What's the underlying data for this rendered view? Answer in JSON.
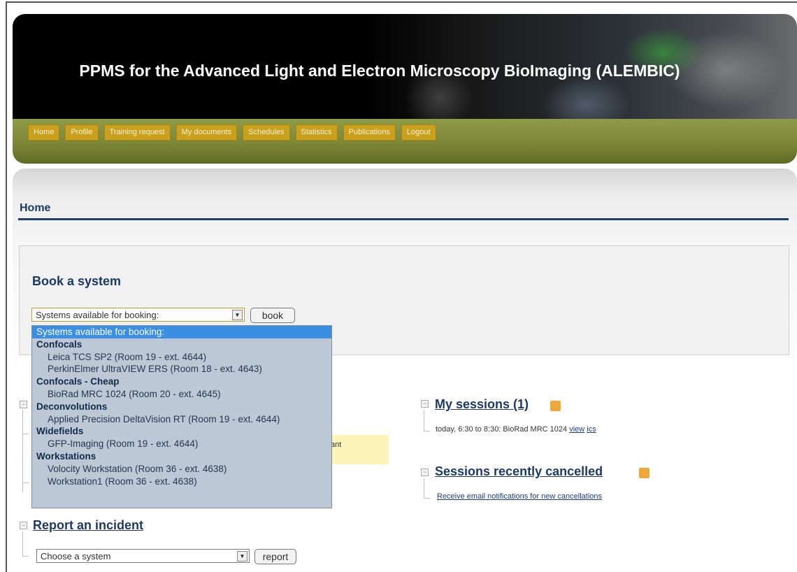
{
  "header": {
    "site_title": "PPMS for the Advanced Light and Electron Microscopy BioImaging (ALEMBIC)",
    "nav": [
      "Home",
      "Profile",
      "Training request",
      "My documents",
      "Schedules",
      "Statistics",
      "Publications",
      "Logout"
    ]
  },
  "page": {
    "title": "Home"
  },
  "book": {
    "heading": "Book a system",
    "select_value": "Systems available for booking:",
    "button": "book",
    "dropdown": [
      {
        "text": "Systems available for booking:",
        "kind": "selected"
      },
      {
        "text": "Confocals",
        "kind": "group"
      },
      {
        "text": "Leica TCS SP2 (Room 19 - ext. 4644)",
        "kind": "option"
      },
      {
        "text": "PerkinElmer UltraVIEW ERS (Room 18 - ext. 4643)",
        "kind": "option"
      },
      {
        "text": "Confocals - Cheap",
        "kind": "group"
      },
      {
        "text": "BioRad MRC 1024 (Room 20 - ext. 4645)",
        "kind": "option"
      },
      {
        "text": "Deconvolutions",
        "kind": "group"
      },
      {
        "text": "Applied Precision DeltaVision RT (Room 19 - ext. 4644)",
        "kind": "option"
      },
      {
        "text": "Widefields",
        "kind": "group"
      },
      {
        "text": "GFP-Imaging (Room 19 - ext. 4644)",
        "kind": "option"
      },
      {
        "text": "Workstations",
        "kind": "group"
      },
      {
        "text": "Volocity Workstation (Room 36 - ext. 4638)",
        "kind": "option"
      },
      {
        "text": "Workstation1 (Room 36 - ext. 4638)",
        "kind": "option"
      }
    ]
  },
  "notice": {
    "partial_text": "ant"
  },
  "my_sessions": {
    "title": "My sessions (1)",
    "entry": "today, 6:30 to 8:30: BioRad MRC 1024",
    "view_link": "view",
    "ics_link": "ics"
  },
  "cancelled": {
    "title": "Sessions recently cancelled",
    "link": "Receive email notifications for new cancellations"
  },
  "incident": {
    "title": "Report an incident",
    "select_value": "Choose a system",
    "button": "report"
  },
  "colors": {
    "nav_button": "#c9a11e",
    "navbar": "#7b8737",
    "title_blue": "#1a3a66",
    "dropdown_bg": "#bcc8d6",
    "dropdown_selected": "#3b8fe3"
  }
}
